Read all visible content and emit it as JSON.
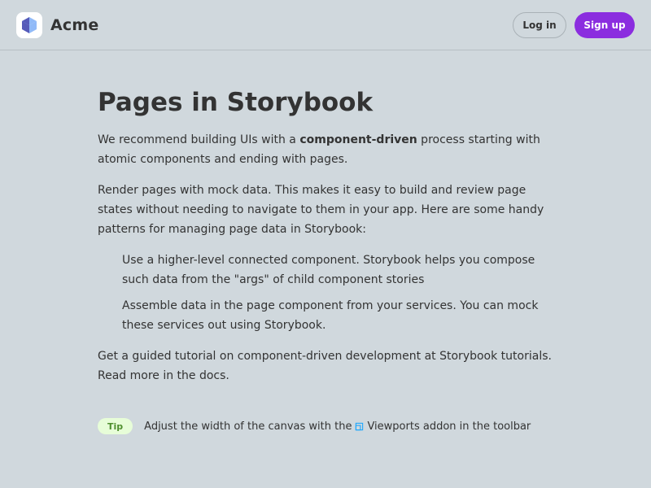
{
  "header": {
    "brand_name": "Acme",
    "login_label": "Log in",
    "signup_label": "Sign up"
  },
  "main": {
    "title": "Pages in Storybook",
    "p1_before": "We recommend building UIs with a ",
    "p1_bold": "component-driven",
    "p1_after": " process starting with atomic components and ending with pages.",
    "p2": "Render pages with mock data. This makes it easy to build and review page states without needing to navigate to them in your app. Here are some handy patterns for managing page data in Storybook:",
    "list_items": [
      "Use a higher-level connected component. Storybook helps you compose such data from the \"args\" of child component stories",
      "Assemble data in the page component from your services. You can mock these services out using Storybook."
    ],
    "p3": "Get a guided tutorial on component-driven development at Storybook tutorials. Read more in the docs."
  },
  "tip": {
    "badge": "Tip",
    "text_before": "Adjust the width of the canvas with the",
    "text_after": "Viewports addon in the toolbar"
  },
  "colors": {
    "background": "#d0d8dd",
    "accent": "#8b2ddf",
    "tip_badge_bg": "#e7fdd8",
    "tip_badge_text": "#4f8f2e",
    "icon_blue": "#1ea7fd"
  },
  "icons": {
    "logo": "cube-logo-icon",
    "viewport": "viewport-icon"
  }
}
